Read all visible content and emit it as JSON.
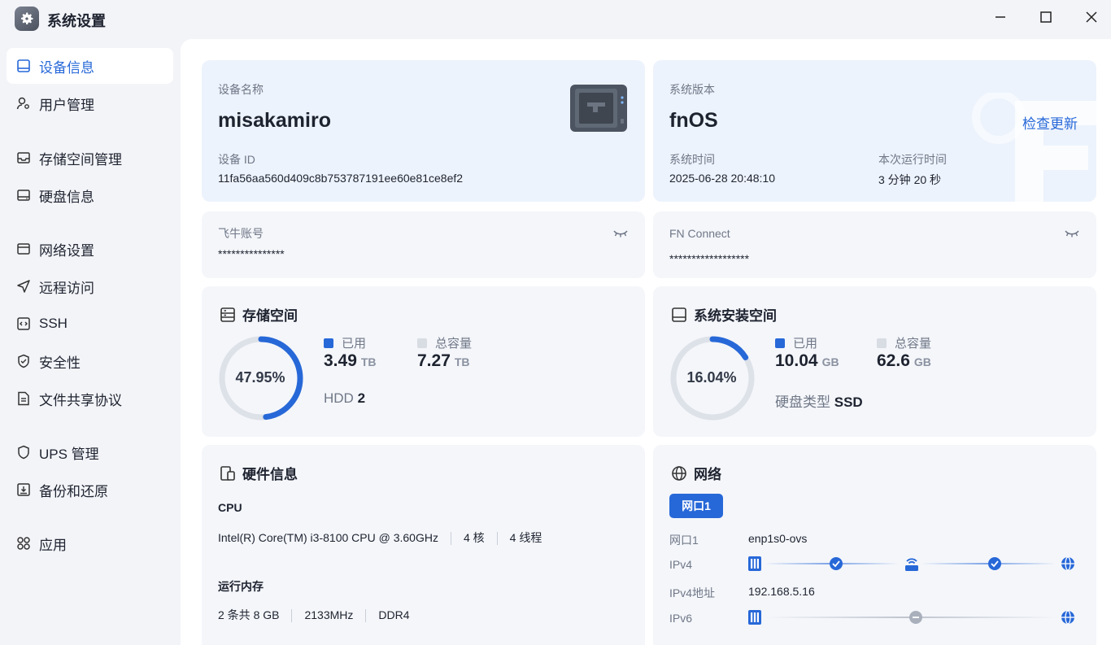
{
  "window": {
    "title": "系统设置",
    "minimize_icon": "minimize-icon",
    "maximize_icon": "maximize-icon",
    "close_icon": "close-icon"
  },
  "sidebar": {
    "items": [
      {
        "label": "设备信息",
        "icon": "device-icon",
        "active": true
      },
      {
        "label": "用户管理",
        "icon": "user-gear-icon"
      },
      {
        "label": "存储空间管理",
        "icon": "storage-icon"
      },
      {
        "label": "硬盘信息",
        "icon": "disk-icon"
      },
      {
        "label": "网络设置",
        "icon": "network-window-icon"
      },
      {
        "label": "远程访问",
        "icon": "send-icon"
      },
      {
        "label": "SSH",
        "icon": "code-icon"
      },
      {
        "label": "安全性",
        "icon": "shield-check-icon"
      },
      {
        "label": "文件共享协议",
        "icon": "file-icon"
      },
      {
        "label": "UPS 管理",
        "icon": "shield-icon"
      },
      {
        "label": "备份和还原",
        "icon": "backup-icon"
      },
      {
        "label": "应用",
        "icon": "apps-icon"
      }
    ]
  },
  "device": {
    "name_label": "设备名称",
    "name": "misakamiro",
    "id_label": "设备 ID",
    "id": "11fa56aa560d409c8b753787191ee60e81ce8ef2"
  },
  "system": {
    "version_label": "系统版本",
    "version": "fnOS",
    "check_update": "检查更新",
    "time_label": "系统时间",
    "time": "2025-06-28 20:48:10",
    "uptime_label": "本次运行时间",
    "uptime": "3 分钟 20 秒"
  },
  "account": {
    "label": "飞牛账号",
    "value": "***************"
  },
  "fn_connect": {
    "label": "FN Connect",
    "value": "******************"
  },
  "storage": {
    "title": "存储空间",
    "percent_text": "47.95%",
    "used_fraction": 0.4795,
    "used_label": "已用",
    "used_value": "3.49",
    "used_unit": "TB",
    "total_label": "总容量",
    "total_value": "7.27",
    "total_unit": "TB",
    "hdd_label": "HDD",
    "hdd_count": "2"
  },
  "sys_space": {
    "title": "系统安装空间",
    "percent_text": "16.04%",
    "used_fraction": 0.1604,
    "used_label": "已用",
    "used_value": "10.04",
    "used_unit": "GB",
    "total_label": "总容量",
    "total_value": "62.6",
    "total_unit": "GB",
    "disk_type_label": "硬盘类型",
    "disk_type": "SSD"
  },
  "hardware": {
    "title": "硬件信息",
    "cpu_label": "CPU",
    "cpu_model": "Intel(R) Core(TM) i3-8100 CPU @ 3.60GHz",
    "cpu_cores": "4 核",
    "cpu_threads": "4 线程",
    "ram_label": "运行内存",
    "ram_size": "2 条共 8 GB",
    "ram_speed": "2133MHz",
    "ram_type": "DDR4"
  },
  "network": {
    "title": "网络",
    "tab": "网口1",
    "port_label": "网口1",
    "port_value": "enp1s0-ovs",
    "ipv4_label": "IPv4",
    "ipv4_addr_label": "IPv4地址",
    "ipv4_addr": "192.168.5.16",
    "ipv6_label": "IPv6"
  },
  "colors": {
    "accent": "#2768d8",
    "ring_track": "#dde1e8",
    "legend_total": "#d8dce3"
  }
}
